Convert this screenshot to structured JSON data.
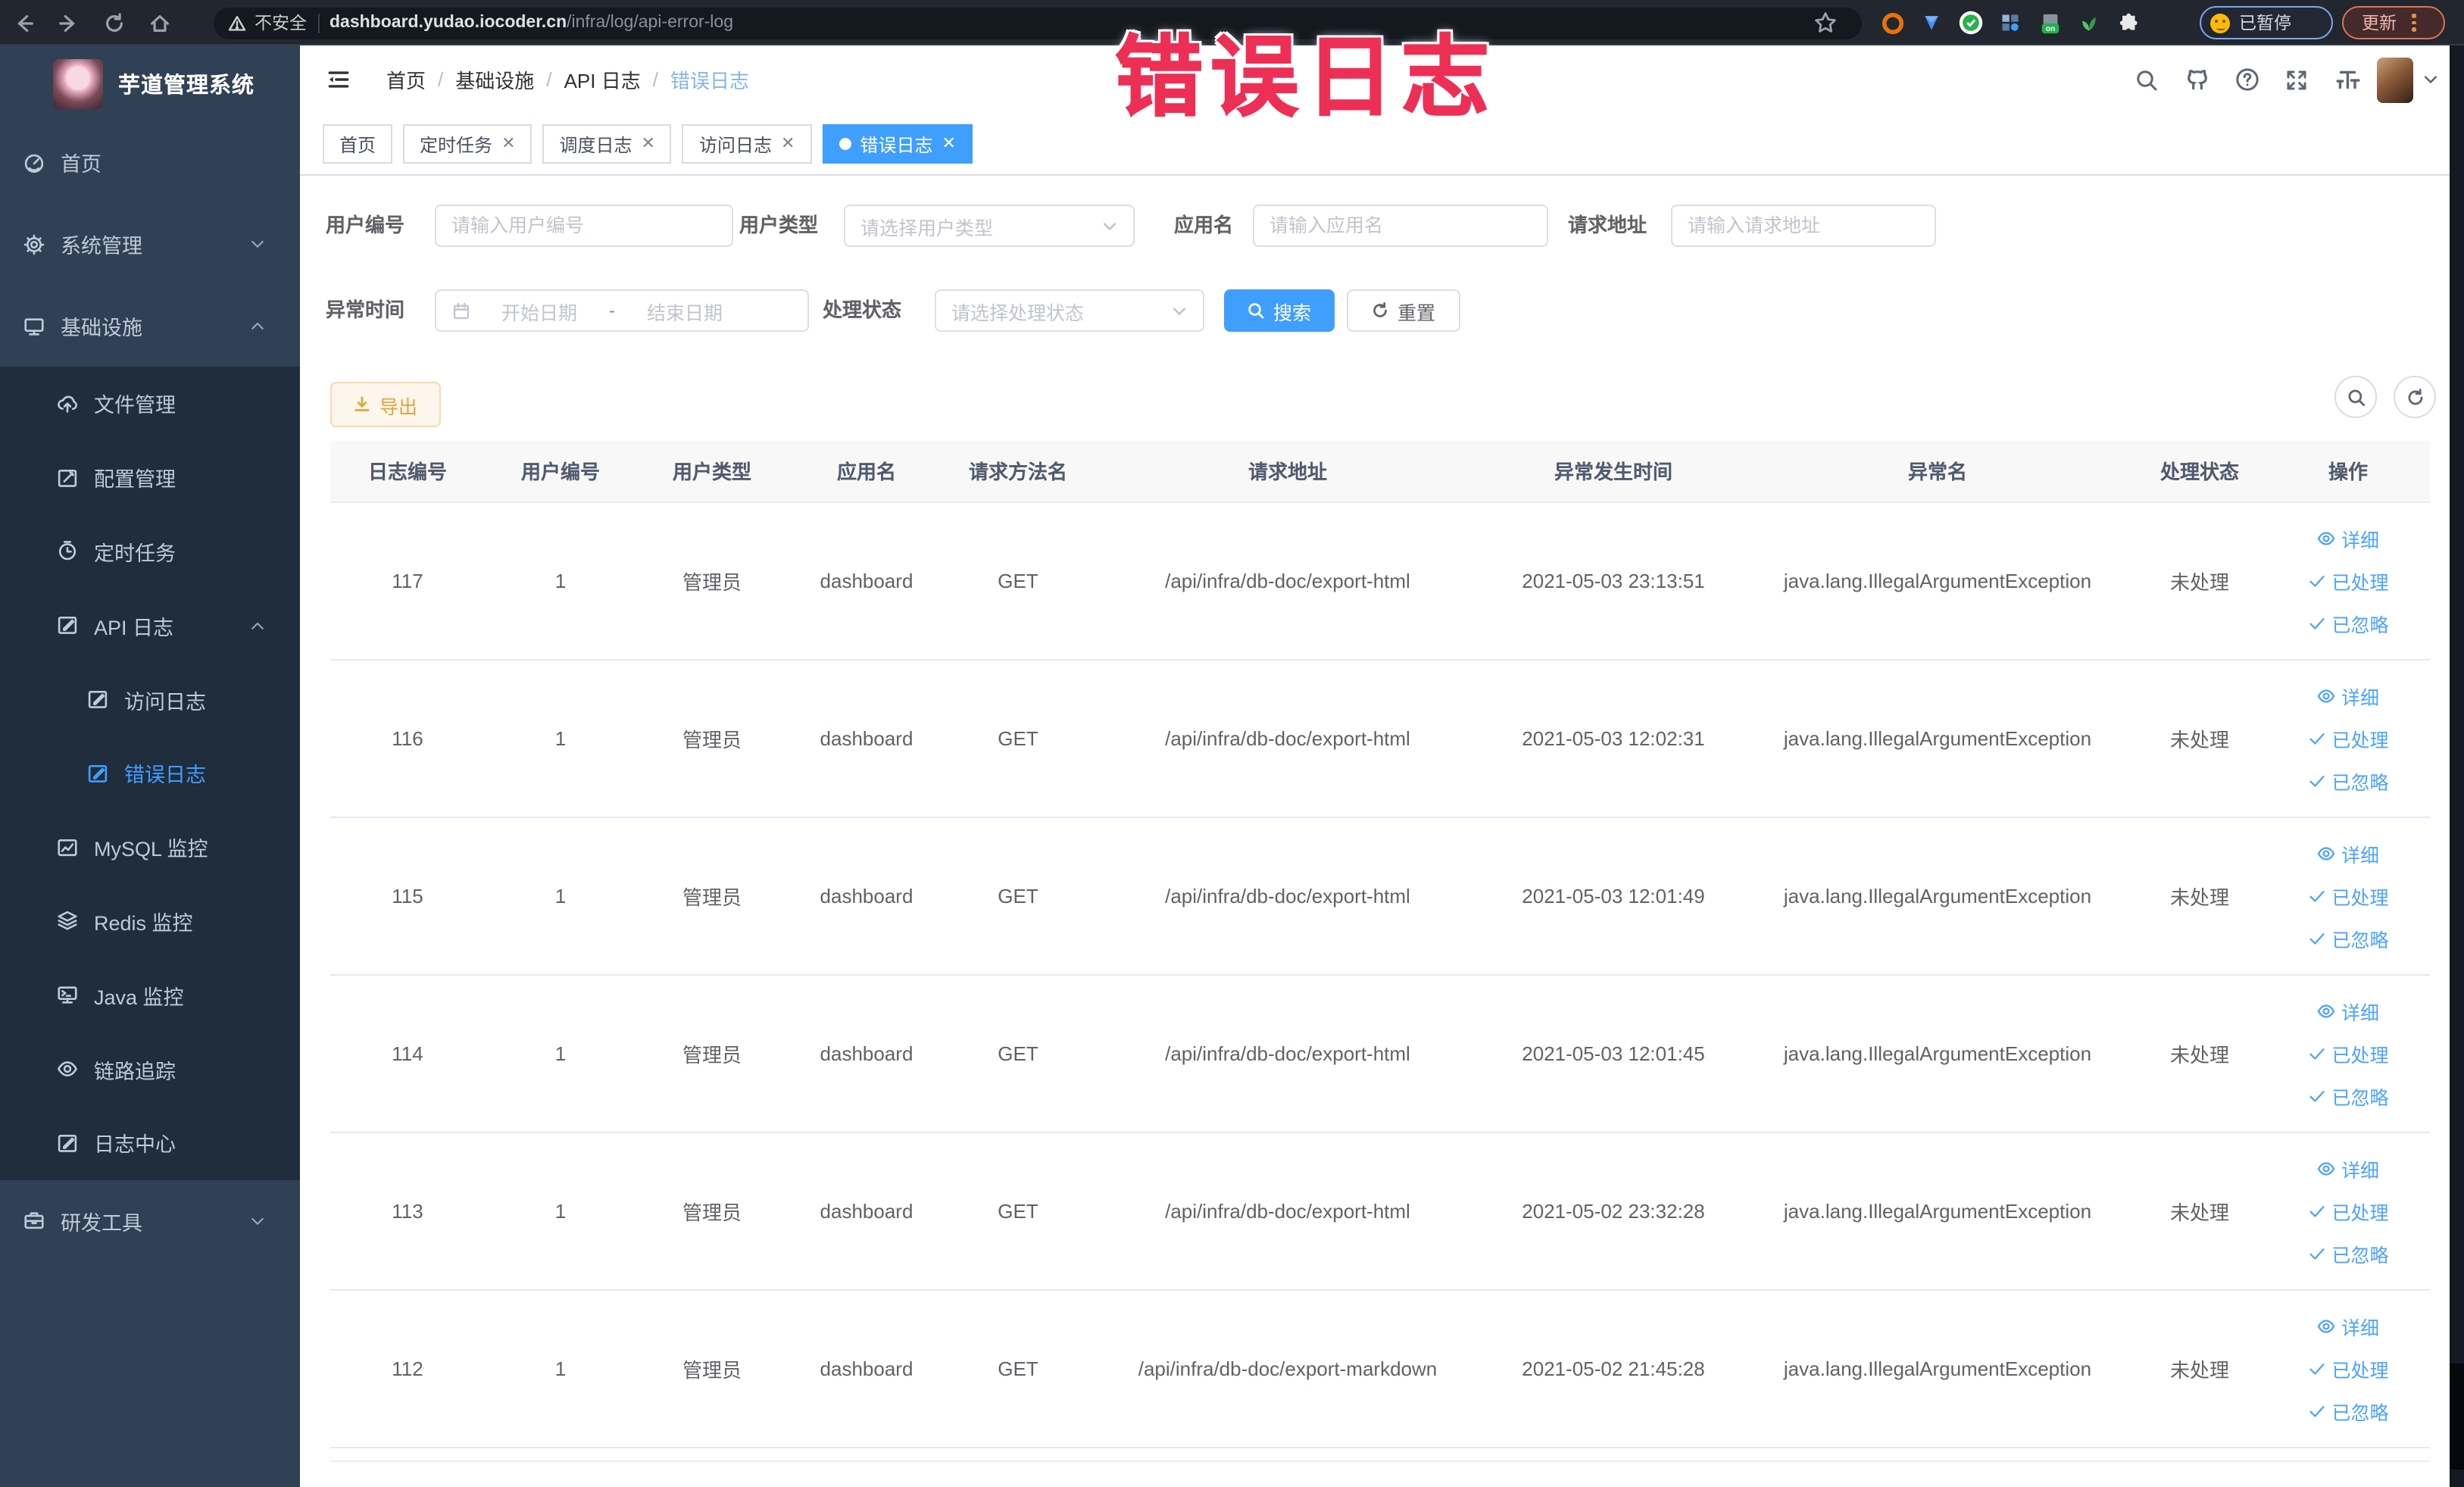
{
  "browser": {
    "security_label": "不安全",
    "url_domain": "dashboard.yudao.iocoder.cn",
    "url_path": "/infra/log/api-error-log",
    "paused_badge": "已暂停",
    "update_button": "更新"
  },
  "annotation": {
    "text": "错误日志",
    "color": "#ee2f55"
  },
  "sidebar": {
    "logo_title": "芋道管理系统",
    "items": [
      {
        "label": "首页",
        "icon": "home-icon",
        "level": 0,
        "dark": false,
        "chevron": "",
        "active": false
      },
      {
        "label": "系统管理",
        "icon": "gear-icon",
        "level": 0,
        "dark": false,
        "chevron": "down",
        "active": false
      },
      {
        "label": "基础设施",
        "icon": "monitor-icon",
        "level": 0,
        "dark": false,
        "chevron": "up",
        "active": false
      },
      {
        "label": "文件管理",
        "icon": "upload-icon",
        "level": 1,
        "dark": true,
        "chevron": "",
        "active": false
      },
      {
        "label": "配置管理",
        "icon": "edit-icon",
        "level": 1,
        "dark": true,
        "chevron": "",
        "active": false
      },
      {
        "label": "定时任务",
        "icon": "timer-icon",
        "level": 1,
        "dark": true,
        "chevron": "",
        "active": false
      },
      {
        "label": "API 日志",
        "icon": "log-icon",
        "level": 1,
        "dark": true,
        "chevron": "up",
        "active": false
      },
      {
        "label": "访问日志",
        "icon": "log-icon",
        "level": 2,
        "dark": true,
        "chevron": "",
        "active": false
      },
      {
        "label": "错误日志",
        "icon": "log-icon",
        "level": 2,
        "dark": true,
        "chevron": "",
        "active": true
      },
      {
        "label": "MySQL 监控",
        "icon": "chart-icon",
        "level": 1,
        "dark": true,
        "chevron": "",
        "active": false
      },
      {
        "label": "Redis 监控",
        "icon": "layers-icon",
        "level": 1,
        "dark": true,
        "chevron": "",
        "active": false
      },
      {
        "label": "Java 监控",
        "icon": "java-icon",
        "level": 1,
        "dark": true,
        "chevron": "",
        "active": false
      },
      {
        "label": "链路追踪",
        "icon": "eye-icon",
        "level": 1,
        "dark": true,
        "chevron": "",
        "active": false
      },
      {
        "label": "日志中心",
        "icon": "log-icon",
        "level": 1,
        "dark": true,
        "chevron": "",
        "active": false
      },
      {
        "label": "研发工具",
        "icon": "toolbox-icon",
        "level": 0,
        "dark": false,
        "chevron": "down",
        "active": false
      }
    ]
  },
  "header": {
    "breadcrumb": [
      "首页",
      "基础设施",
      "API 日志",
      "错误日志"
    ]
  },
  "tabs": [
    {
      "label": "首页",
      "closable": false,
      "active": false
    },
    {
      "label": "定时任务",
      "closable": true,
      "active": false
    },
    {
      "label": "调度日志",
      "closable": true,
      "active": false
    },
    {
      "label": "访问日志",
      "closable": true,
      "active": false
    },
    {
      "label": "错误日志",
      "closable": true,
      "active": true
    }
  ],
  "filters": {
    "row1": [
      {
        "label": "用户编号",
        "type": "input",
        "placeholder": "请输入用户编号"
      },
      {
        "label": "用户类型",
        "type": "select",
        "placeholder": "请选择用户类型"
      },
      {
        "label": "应用名",
        "type": "input",
        "placeholder": "请输入应用名"
      },
      {
        "label": "请求地址",
        "type": "input",
        "placeholder": "请输入请求地址"
      }
    ],
    "time_label": "异常时间",
    "date_start": "开始日期",
    "date_separator": "-",
    "date_end": "结束日期",
    "status_label": "处理状态",
    "status_placeholder": "请选择处理状态",
    "search_label": "搜索",
    "reset_label": "重置"
  },
  "toolbar": {
    "export_label": "导出"
  },
  "table": {
    "columns": [
      "日志编号",
      "用户编号",
      "用户类型",
      "应用名",
      "请求方法名",
      "请求地址",
      "异常发生时间",
      "异常名",
      "处理状态",
      "操作"
    ],
    "actions": [
      "详细",
      "已处理",
      "已忽略"
    ],
    "rows": [
      {
        "id": "117",
        "user_id": "1",
        "user_type": "管理员",
        "app": "dashboard",
        "method": "GET",
        "url": "/api/infra/db-doc/export-html",
        "time": "2021-05-03 23:13:51",
        "exception": "java.lang.IllegalArgumentException",
        "status": "未处理"
      },
      {
        "id": "116",
        "user_id": "1",
        "user_type": "管理员",
        "app": "dashboard",
        "method": "GET",
        "url": "/api/infra/db-doc/export-html",
        "time": "2021-05-03 12:02:31",
        "exception": "java.lang.IllegalArgumentException",
        "status": "未处理"
      },
      {
        "id": "115",
        "user_id": "1",
        "user_type": "管理员",
        "app": "dashboard",
        "method": "GET",
        "url": "/api/infra/db-doc/export-html",
        "time": "2021-05-03 12:01:49",
        "exception": "java.lang.IllegalArgumentException",
        "status": "未处理"
      },
      {
        "id": "114",
        "user_id": "1",
        "user_type": "管理员",
        "app": "dashboard",
        "method": "GET",
        "url": "/api/infra/db-doc/export-html",
        "time": "2021-05-03 12:01:45",
        "exception": "java.lang.IllegalArgumentException",
        "status": "未处理"
      },
      {
        "id": "113",
        "user_id": "1",
        "user_type": "管理员",
        "app": "dashboard",
        "method": "GET",
        "url": "/api/infra/db-doc/export-html",
        "time": "2021-05-02 23:32:28",
        "exception": "java.lang.IllegalArgumentException",
        "status": "未处理"
      },
      {
        "id": "112",
        "user_id": "1",
        "user_type": "管理员",
        "app": "dashboard",
        "method": "GET",
        "url": "/api/infra/db-doc/export-markdown",
        "time": "2021-05-02 21:45:28",
        "exception": "java.lang.IllegalArgumentException",
        "status": "未处理"
      }
    ]
  }
}
